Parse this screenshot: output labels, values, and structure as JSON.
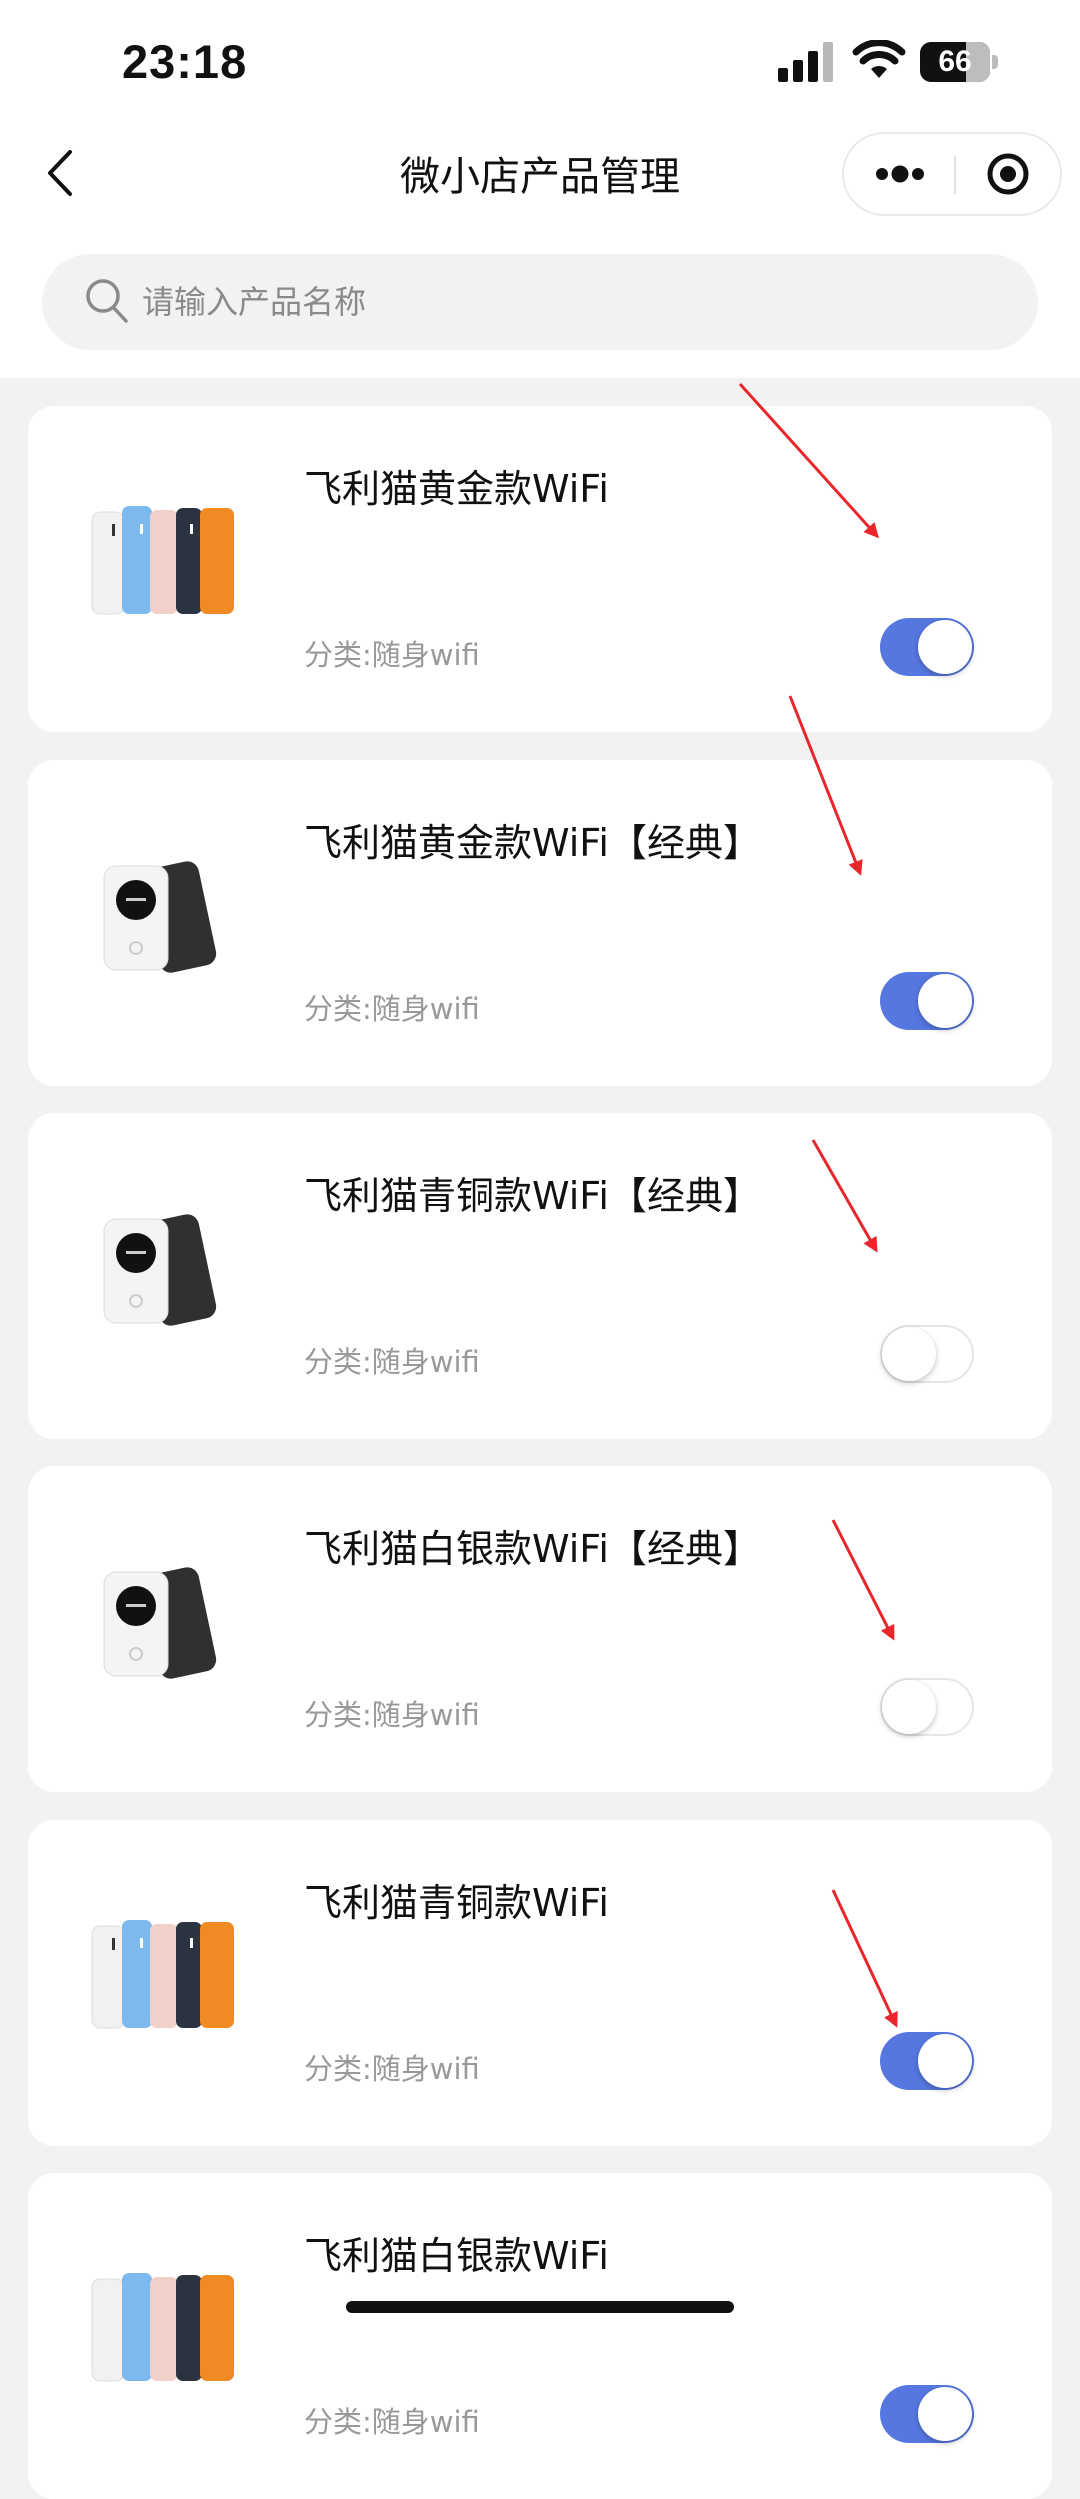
{
  "status_bar": {
    "time": "23:18",
    "battery": "66",
    "battery_level": 0.66
  },
  "nav": {
    "title": "微小店产品管理"
  },
  "search": {
    "placeholder": "请输入产品名称",
    "value": ""
  },
  "colors": {
    "accent": "#5677e0",
    "arrow": "#e8262b",
    "background": "#f2f2f2"
  },
  "products": [
    {
      "name": "飞利猫黄金款WiFi",
      "category": "分类:随身wifi",
      "enabled": true,
      "image": "multicolor-devices"
    },
    {
      "name": "飞利猫黄金款WiFi【经典】",
      "category": "分类:随身wifi",
      "enabled": true,
      "image": "white-black-devices"
    },
    {
      "name": "飞利猫青铜款WiFi【经典】",
      "category": "分类:随身wifi",
      "enabled": false,
      "image": "white-black-devices"
    },
    {
      "name": "飞利猫白银款WiFi【经典】",
      "category": "分类:随身wifi",
      "enabled": false,
      "image": "white-black-devices"
    },
    {
      "name": "飞利猫青铜款WiFi",
      "category": "分类:随身wifi",
      "enabled": true,
      "image": "multicolor-devices"
    },
    {
      "name": "飞利猫白银款WiFi",
      "category": "分类:随身wifi",
      "enabled": true,
      "image": "multicolor-devices"
    }
  ]
}
